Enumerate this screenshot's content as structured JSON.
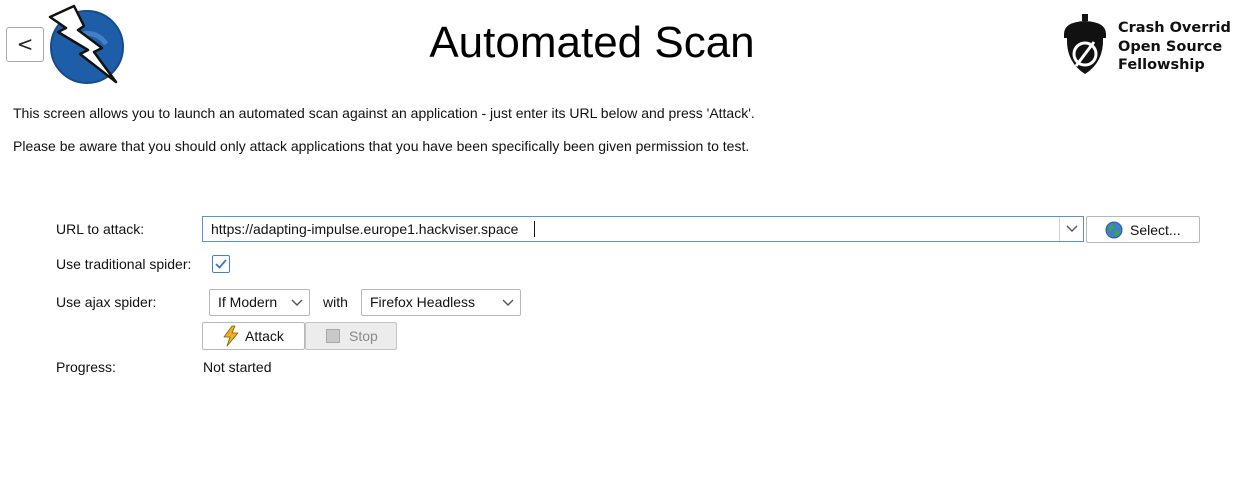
{
  "header": {
    "back_label": "<",
    "title": "Automated Scan",
    "brand_lines": [
      "Crash Overrid",
      "Open Source",
      "Fellowship"
    ]
  },
  "description": {
    "line1": "This screen allows you to launch an automated scan against  an application - just enter its URL below and press 'Attack'.",
    "line2": "Please be aware that you should only attack applications that you have been specifically been given permission to test."
  },
  "form": {
    "url_label": "URL to attack:",
    "url_value": "https://adapting-impulse.europe1.hackviser.space",
    "select_label": "Select...",
    "traditional_spider_label": "Use traditional spider:",
    "traditional_spider_checked": true,
    "ajax_spider_label": "Use ajax spider:",
    "ajax_mode": "If Modern",
    "with_label": "with",
    "browser": "Firefox Headless",
    "attack_label": "Attack",
    "stop_label": "Stop",
    "progress_label": "Progress:",
    "progress_value": "Not started"
  },
  "icons": {
    "zap_logo": "zap-lightning-logo",
    "brand_logo": "acorn-logo",
    "globe": "globe-icon",
    "bolt": "lightning-bolt-icon",
    "stop": "stop-square-icon",
    "chevron": "chevron-down-icon",
    "check": "checkmark-icon"
  },
  "colors": {
    "accent_border": "#5b8fd6",
    "check_color": "#3a78c9",
    "bolt_color": "#f0b020",
    "zap_blue": "#1e5ea8"
  }
}
